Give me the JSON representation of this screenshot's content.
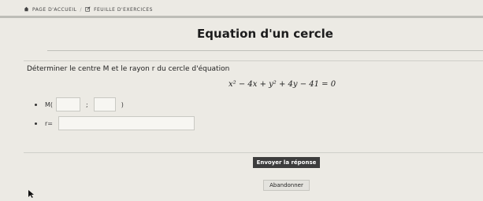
{
  "breadcrumb": {
    "home_label": "PAGE D'ACCUEIL",
    "separator": "/",
    "exercises_label": "FEUILLE D'EXERCICES"
  },
  "page_title": "Equation d'un cercle",
  "instruction": "Déterminer le centre M et le rayon r du cercle d'équation",
  "equation": "x² − 4x + y² + 4y − 41 = 0",
  "fields": {
    "center_label": "M(",
    "center_separator": ";",
    "center_close": ")",
    "radius_label": "r=",
    "center_x_value": "",
    "center_y_value": "",
    "radius_value": ""
  },
  "buttons": {
    "submit_label": "Envoyer la réponse",
    "cancel_label": "Abandonner"
  }
}
